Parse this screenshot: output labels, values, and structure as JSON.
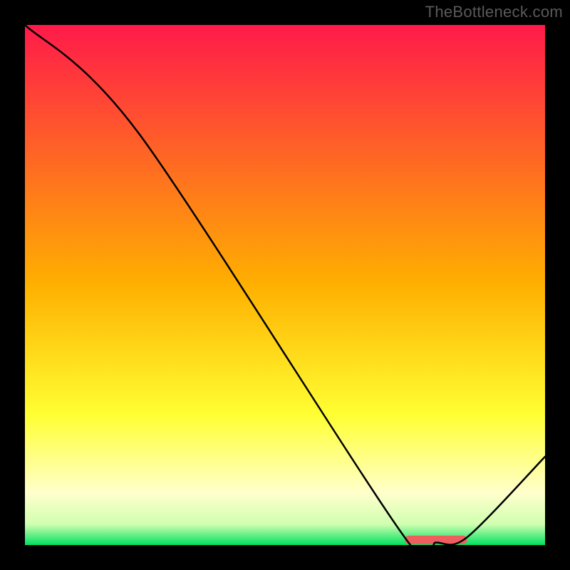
{
  "watermark": "TheBottleneck.com",
  "chart_data": {
    "type": "line",
    "title": "",
    "xlabel": "",
    "ylabel": "",
    "xlim": [
      0,
      100
    ],
    "ylim": [
      0,
      100
    ],
    "x": [
      0,
      22,
      73,
      79,
      85,
      100
    ],
    "series": [
      {
        "name": "curve",
        "values": [
          100,
          79,
          1.5,
          0.5,
          1.5,
          17
        ]
      }
    ],
    "annotations": [
      {
        "type": "bar",
        "x_start": 73,
        "x_end": 85,
        "y": 1,
        "color": "#ef5e5e"
      }
    ],
    "background": "vertical-gradient",
    "gradient_stops": [
      {
        "pos": 0.0,
        "color": "#ff1a4a"
      },
      {
        "pos": 0.5,
        "color": "#ffb000"
      },
      {
        "pos": 0.75,
        "color": "#ffff33"
      },
      {
        "pos": 0.9,
        "color": "#ffffcc"
      },
      {
        "pos": 0.96,
        "color": "#d0ffb0"
      },
      {
        "pos": 1.0,
        "color": "#00e060"
      }
    ]
  }
}
